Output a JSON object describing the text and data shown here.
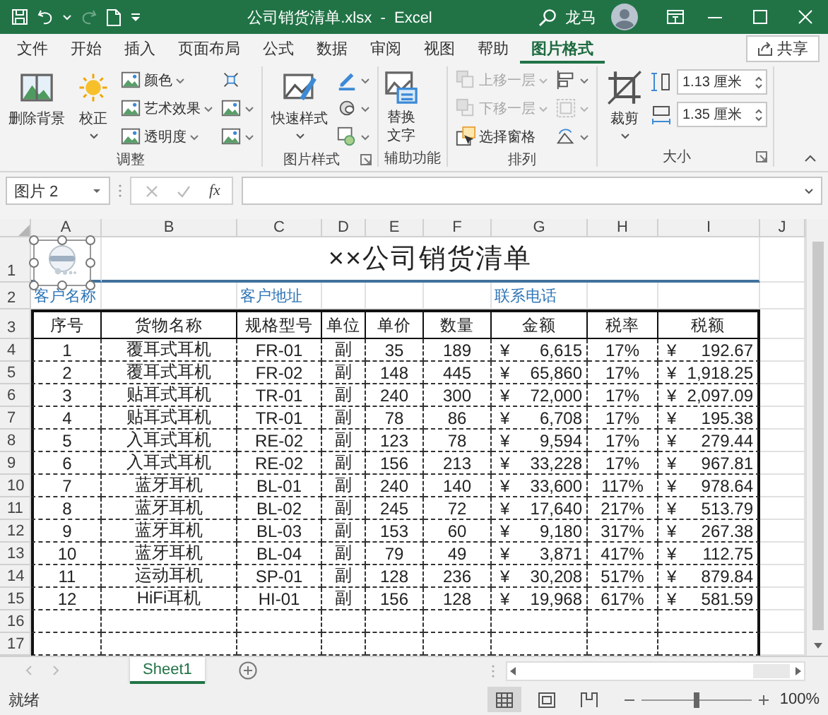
{
  "title_bar": {
    "title": "公司销货清单.xlsx  -  Excel",
    "user": "龙马"
  },
  "ribbon_tabs": [
    {
      "label": "文件",
      "selected": false
    },
    {
      "label": "开始",
      "selected": false
    },
    {
      "label": "插入",
      "selected": false
    },
    {
      "label": "页面布局",
      "selected": false
    },
    {
      "label": "公式",
      "selected": false
    },
    {
      "label": "数据",
      "selected": false
    },
    {
      "label": "审阅",
      "selected": false
    },
    {
      "label": "视图",
      "selected": false
    },
    {
      "label": "帮助",
      "selected": false
    },
    {
      "label": "图片格式",
      "selected": true
    }
  ],
  "share_button": "共享",
  "ribbon_groups": [
    {
      "label": "调整",
      "launcher": false,
      "columns": [
        [
          {
            "kind": "large",
            "label": "删除背景",
            "dropdown": false,
            "disabled": false
          }
        ],
        [
          {
            "kind": "large",
            "label": "校正",
            "dropdown": true,
            "disabled": false
          }
        ],
        [
          {
            "kind": "small",
            "label": "颜色",
            "dropdown": true,
            "disabled": false
          },
          {
            "kind": "small",
            "label": "艺术效果",
            "dropdown": true,
            "disabled": false
          },
          {
            "kind": "small",
            "label": "透明度",
            "dropdown": true,
            "disabled": false
          }
        ],
        [
          {
            "kind": "icon",
            "dropdown": false,
            "disabled": false
          },
          {
            "kind": "icon",
            "dropdown": true,
            "disabled": false
          },
          {
            "kind": "icon",
            "dropdown": true,
            "disabled": false
          }
        ]
      ]
    },
    {
      "label": "图片样式",
      "launcher": true,
      "columns": [
        [
          {
            "kind": "large",
            "label": "快速样式",
            "dropdown": true,
            "disabled": false
          }
        ],
        [
          {
            "kind": "icon",
            "dropdown": true,
            "disabled": false
          },
          {
            "kind": "icon",
            "dropdown": true,
            "disabled": false
          },
          {
            "kind": "icon",
            "dropdown": true,
            "disabled": false
          }
        ]
      ]
    },
    {
      "label": "辅助功能",
      "launcher": false,
      "columns": [
        [
          {
            "kind": "tall",
            "label": "替换文字",
            "dropdown": false,
            "disabled": false
          }
        ]
      ]
    },
    {
      "label": "排列",
      "launcher": false,
      "columns": [
        [
          {
            "kind": "small",
            "label": "上移一层",
            "dropdown": true,
            "disabled": true
          },
          {
            "kind": "small",
            "label": "下移一层",
            "dropdown": true,
            "disabled": true
          },
          {
            "kind": "small",
            "label": "选择窗格",
            "dropdown": false,
            "disabled": false
          }
        ],
        [
          {
            "kind": "icon",
            "dropdown": true,
            "disabled": false
          },
          {
            "kind": "icon",
            "dropdown": true,
            "disabled": true
          },
          {
            "kind": "icon",
            "dropdown": true,
            "disabled": false
          }
        ]
      ]
    },
    {
      "label": "大小",
      "launcher": true,
      "columns": [
        [
          {
            "kind": "large",
            "label": "裁剪",
            "dropdown": true,
            "disabled": false
          }
        ],
        [
          {
            "kind": "spin",
            "value": "1.13 厘米"
          },
          {
            "kind": "spin",
            "value": "1.35 厘米"
          }
        ]
      ]
    }
  ],
  "formula_bar": {
    "name_box": "图片 2",
    "function_label": "fx"
  },
  "sheet": {
    "columns": [
      "A",
      "B",
      "C",
      "D",
      "E",
      "F",
      "G",
      "H",
      "I",
      "J"
    ],
    "row_numbers": [
      "1",
      "2",
      "3",
      "4",
      "5",
      "6",
      "7",
      "8",
      "9",
      "10",
      "11",
      "12",
      "13",
      "14",
      "15",
      "16",
      "17"
    ],
    "title": "××公司销货清单",
    "info_labels": [
      "客户名称",
      "客户地址",
      "联系电话"
    ],
    "headers": [
      "序号",
      "货物名称",
      "规格型号",
      "单位",
      "单价",
      "数量",
      "金额",
      "税率",
      "税额"
    ],
    "rows": [
      {
        "cells": [
          "1",
          "覆耳式耳机",
          "FR-01",
          "副",
          "35",
          "189",
          {
            "symbol": "¥",
            "value": "6,615"
          },
          "17%",
          {
            "symbol": "¥",
            "value": "192.67"
          }
        ]
      },
      {
        "cells": [
          "2",
          "覆耳式耳机",
          "FR-02",
          "副",
          "148",
          "445",
          {
            "symbol": "¥",
            "value": "65,860"
          },
          "17%",
          {
            "symbol": "¥",
            "value": "1,918.25"
          }
        ]
      },
      {
        "cells": [
          "3",
          "贴耳式耳机",
          "TR-01",
          "副",
          "240",
          "300",
          {
            "symbol": "¥",
            "value": "72,000"
          },
          "17%",
          {
            "symbol": "¥",
            "value": "2,097.09"
          }
        ]
      },
      {
        "cells": [
          "4",
          "贴耳式耳机",
          "TR-01",
          "副",
          "78",
          "86",
          {
            "symbol": "¥",
            "value": "6,708"
          },
          "17%",
          {
            "symbol": "¥",
            "value": "195.38"
          }
        ]
      },
      {
        "cells": [
          "5",
          "入耳式耳机",
          "RE-02",
          "副",
          "123",
          "78",
          {
            "symbol": "¥",
            "value": "9,594"
          },
          "17%",
          {
            "symbol": "¥",
            "value": "279.44"
          }
        ]
      },
      {
        "cells": [
          "6",
          "入耳式耳机",
          "RE-02",
          "副",
          "156",
          "213",
          {
            "symbol": "¥",
            "value": "33,228"
          },
          "17%",
          {
            "symbol": "¥",
            "value": "967.81"
          }
        ]
      },
      {
        "cells": [
          "7",
          "蓝牙耳机",
          "BL-01",
          "副",
          "240",
          "140",
          {
            "symbol": "¥",
            "value": "33,600"
          },
          "117%",
          {
            "symbol": "¥",
            "value": "978.64"
          }
        ]
      },
      {
        "cells": [
          "8",
          "蓝牙耳机",
          "BL-02",
          "副",
          "245",
          "72",
          {
            "symbol": "¥",
            "value": "17,640"
          },
          "217%",
          {
            "symbol": "¥",
            "value": "513.79"
          }
        ]
      },
      {
        "cells": [
          "9",
          "蓝牙耳机",
          "BL-03",
          "副",
          "153",
          "60",
          {
            "symbol": "¥",
            "value": "9,180"
          },
          "317%",
          {
            "symbol": "¥",
            "value": "267.38"
          }
        ]
      },
      {
        "cells": [
          "10",
          "蓝牙耳机",
          "BL-04",
          "副",
          "79",
          "49",
          {
            "symbol": "¥",
            "value": "3,871"
          },
          "417%",
          {
            "symbol": "¥",
            "value": "112.75"
          }
        ]
      },
      {
        "cells": [
          "11",
          "运动耳机",
          "SP-01",
          "副",
          "128",
          "236",
          {
            "symbol": "¥",
            "value": "30,208"
          },
          "517%",
          {
            "symbol": "¥",
            "value": "879.84"
          }
        ]
      },
      {
        "cells": [
          "12",
          "HiFi耳机",
          "HI-01",
          "副",
          "156",
          "128",
          {
            "symbol": "¥",
            "value": "19,968"
          },
          "617%",
          {
            "symbol": "¥",
            "value": "581.59"
          }
        ]
      }
    ]
  },
  "sheet_tabs": [
    {
      "label": "Sheet1",
      "selected": true
    }
  ],
  "status_bar": {
    "status": "就绪",
    "views": [
      {
        "selected": true
      },
      {
        "selected": false
      },
      {
        "selected": false
      }
    ],
    "zoom": {
      "level": 0.5,
      "reading": "100%"
    }
  }
}
